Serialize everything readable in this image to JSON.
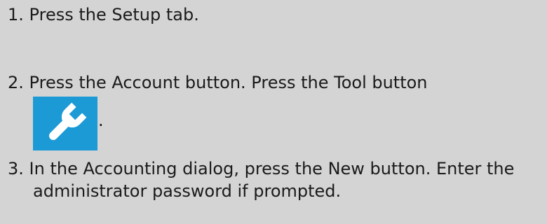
{
  "steps": [
    {
      "number": "1.",
      "text": "Press the Setup tab."
    },
    {
      "number": "2.",
      "text": "Press the Account button. Press the Tool button",
      "icon": "wrench-icon",
      "icon_color": "#1c9ad6",
      "suffix": "."
    },
    {
      "number": "3.",
      "text": "In the Accounting dialog, press the New button. Enter the",
      "text_line2": "administrator password if prompted."
    }
  ],
  "background_color": "#d4d4d4"
}
